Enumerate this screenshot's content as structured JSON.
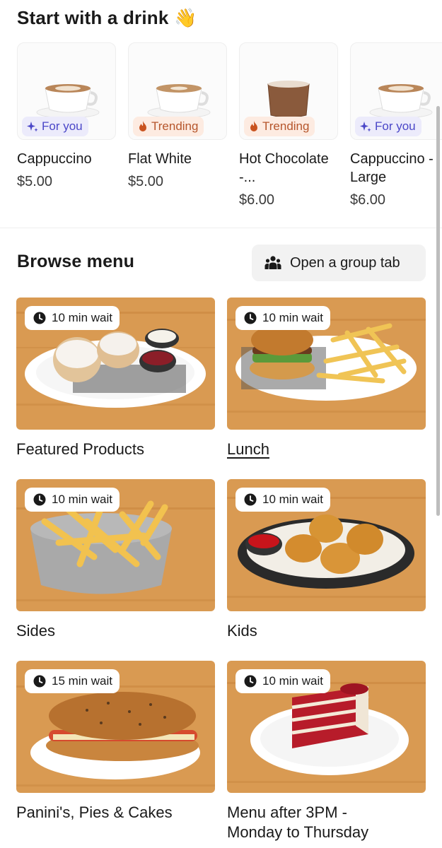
{
  "drinks_section": {
    "title": "Start with a drink 👋",
    "items": [
      {
        "name": "Cappuccino",
        "price": "$5.00",
        "badge": "For you",
        "badge_type": "for-you",
        "drink": "cappuccino"
      },
      {
        "name": "Flat White",
        "price": "$5.00",
        "badge": "Trending",
        "badge_type": "trending",
        "drink": "flat-white"
      },
      {
        "name": "Hot Chocolate -...",
        "price": "$6.00",
        "badge": "Trending",
        "badge_type": "trending",
        "drink": "hot-chocolate"
      },
      {
        "name": "Cappuccino - Large",
        "price": "$6.00",
        "badge": "For you",
        "badge_type": "for-you",
        "drink": "cappuccino"
      }
    ]
  },
  "browse_section": {
    "title": "Browse menu",
    "group_tab_button": "Open a group tab",
    "categories": [
      {
        "label": "Featured Products",
        "wait": "10 min wait",
        "image": "scones-icon"
      },
      {
        "label": "Lunch",
        "wait": "10 min wait",
        "image": "burger-fries-icon"
      },
      {
        "label": "Sides",
        "wait": "10 min wait",
        "image": "fries-bowl-icon"
      },
      {
        "label": "Kids",
        "wait": "10 min wait",
        "image": "nuggets-basket-icon"
      },
      {
        "label": "Panini's, Pies & Cakes",
        "wait": "15 min wait",
        "image": "panini-icon"
      },
      {
        "label": "Menu after 3PM - Monday to Thursday",
        "wait": "10 min wait",
        "image": "red-velvet-cake-icon"
      }
    ]
  },
  "colors": {
    "for_you_bg": "#ecebfb",
    "for_you_text": "#4b47c8",
    "trending_bg": "#fdebe1",
    "trending_text": "#b6562c",
    "wood": "#d99a52"
  }
}
